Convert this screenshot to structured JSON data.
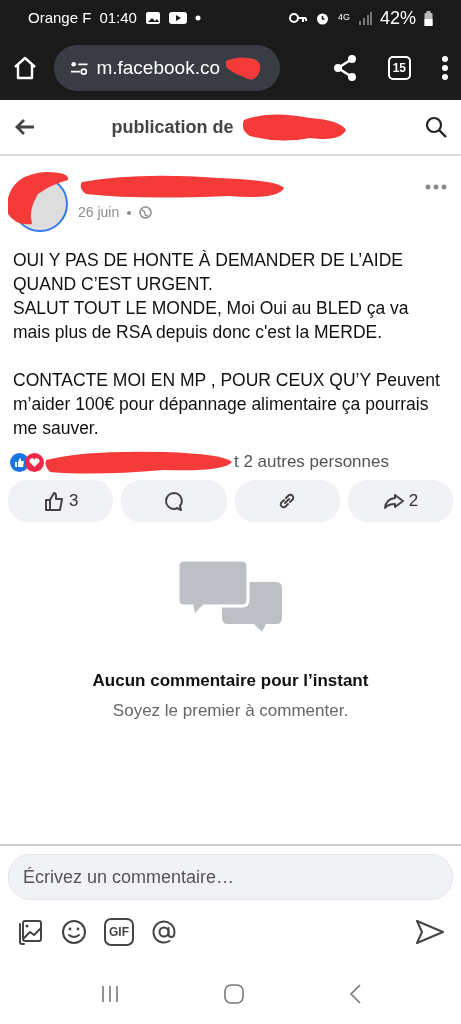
{
  "status_bar": {
    "carrier": "Orange F",
    "time": "01:40",
    "network": "4G",
    "battery": "42%"
  },
  "browser": {
    "url": "m.facebook.co",
    "tab_count": "15"
  },
  "header": {
    "title": "publication de"
  },
  "post": {
    "date": "26 juin",
    "blocks": [
      {
        "lines": [
          "OUI Y PAS DE HONTE À DEMANDER DE L’AIDE QUAND C’EST URGENT.",
          "SALUT TOUT LE MONDE,  Moi Oui au BLED ça va mais plus de RSA depuis donc c'est la MERDE."
        ]
      },
      {
        "lines": [
          "CONTACTE MOI EN MP , POUR CEUX QU’Y Peuvent m’aider 100€ pour dépannage alimentaire ça pourrais me sauver."
        ]
      }
    ],
    "reactions_text": "t 2 autres personnes",
    "actions": [
      {
        "kind": "like",
        "count": "3"
      },
      {
        "kind": "comment"
      },
      {
        "kind": "link"
      },
      {
        "kind": "share",
        "count": "2"
      }
    ]
  },
  "empty_state": {
    "title": "Aucun commentaire pour l’instant",
    "subtitle": "Soyez le premier à commenter."
  },
  "composer": {
    "placeholder": "Écrivez un commentaire…",
    "gif_label": "GIF"
  }
}
